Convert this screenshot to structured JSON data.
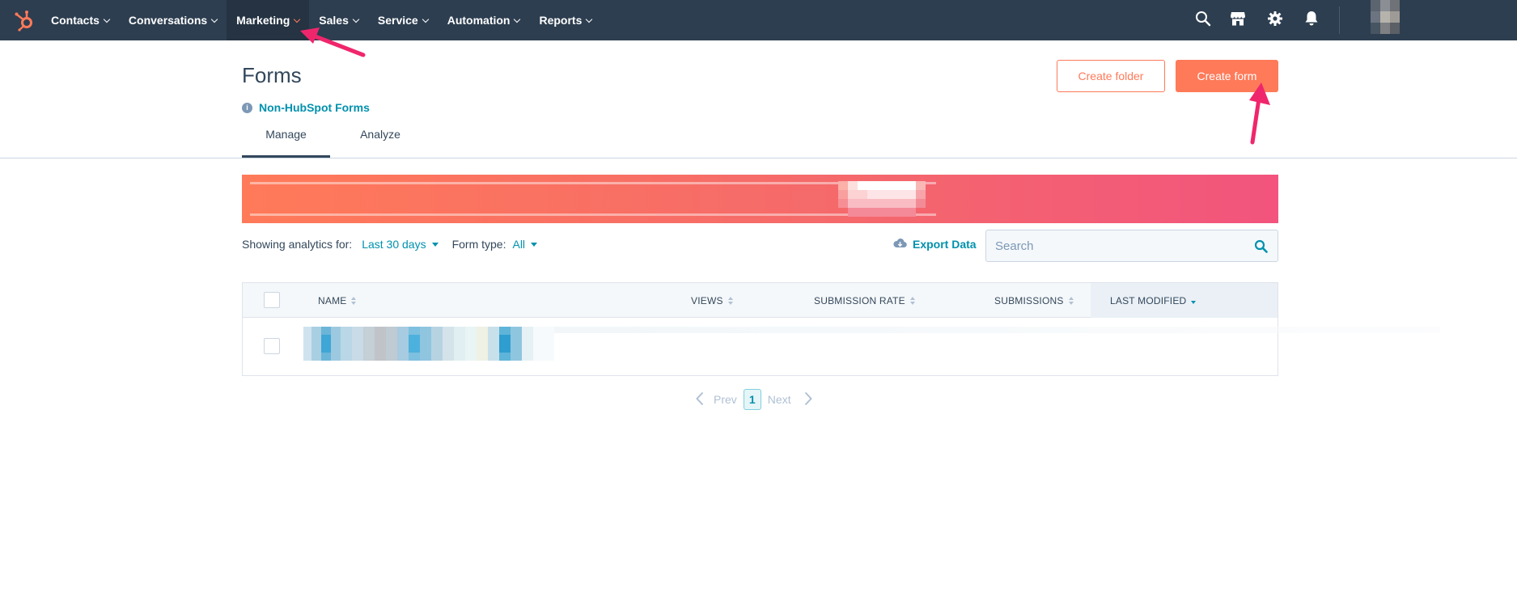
{
  "topnav": {
    "items": [
      {
        "label": "Contacts"
      },
      {
        "label": "Conversations"
      },
      {
        "label": "Marketing"
      },
      {
        "label": "Sales"
      },
      {
        "label": "Service"
      },
      {
        "label": "Automation"
      },
      {
        "label": "Reports"
      }
    ],
    "active_item": "Marketing",
    "icons": [
      "search-icon",
      "marketplace-icon",
      "settings-gear-icon",
      "notifications-bell-icon"
    ],
    "colors": {
      "bar": "#2d3e50",
      "active": "#253342",
      "logo": "#ff7a59"
    }
  },
  "header": {
    "title": "Forms",
    "create_folder_label": "Create folder",
    "create_form_label": "Create form",
    "non_hubspot_link": "Non-HubSpot Forms"
  },
  "tabs": [
    {
      "label": "Manage",
      "active": true
    },
    {
      "label": "Analyze",
      "active": false
    }
  ],
  "filters": {
    "analytics_label": "Showing analytics for:",
    "analytics_value": "Last 30 days",
    "form_type_label": "Form type:",
    "form_type_value": "All",
    "export_label": "Export Data",
    "search_placeholder": "Search"
  },
  "table": {
    "columns": [
      {
        "label": "NAME",
        "sorted": false
      },
      {
        "label": "VIEWS",
        "sorted": false
      },
      {
        "label": "SUBMISSION RATE",
        "sorted": false
      },
      {
        "label": "SUBMISSIONS",
        "sorted": false
      },
      {
        "label": "LAST MODIFIED",
        "sorted": true,
        "direction": "descending"
      }
    ],
    "rows": [
      {
        "name": "",
        "views": "",
        "submission_rate": "",
        "submissions": "",
        "last_modified": "",
        "redacted": true
      }
    ]
  },
  "pagination": {
    "prev_label": "Prev",
    "current_page": "1",
    "next_label": "Next"
  },
  "colors": {
    "accent": "#ff7a59",
    "link": "#0091ae",
    "text": "#33475b",
    "annotation_arrow": "#f0266c"
  }
}
